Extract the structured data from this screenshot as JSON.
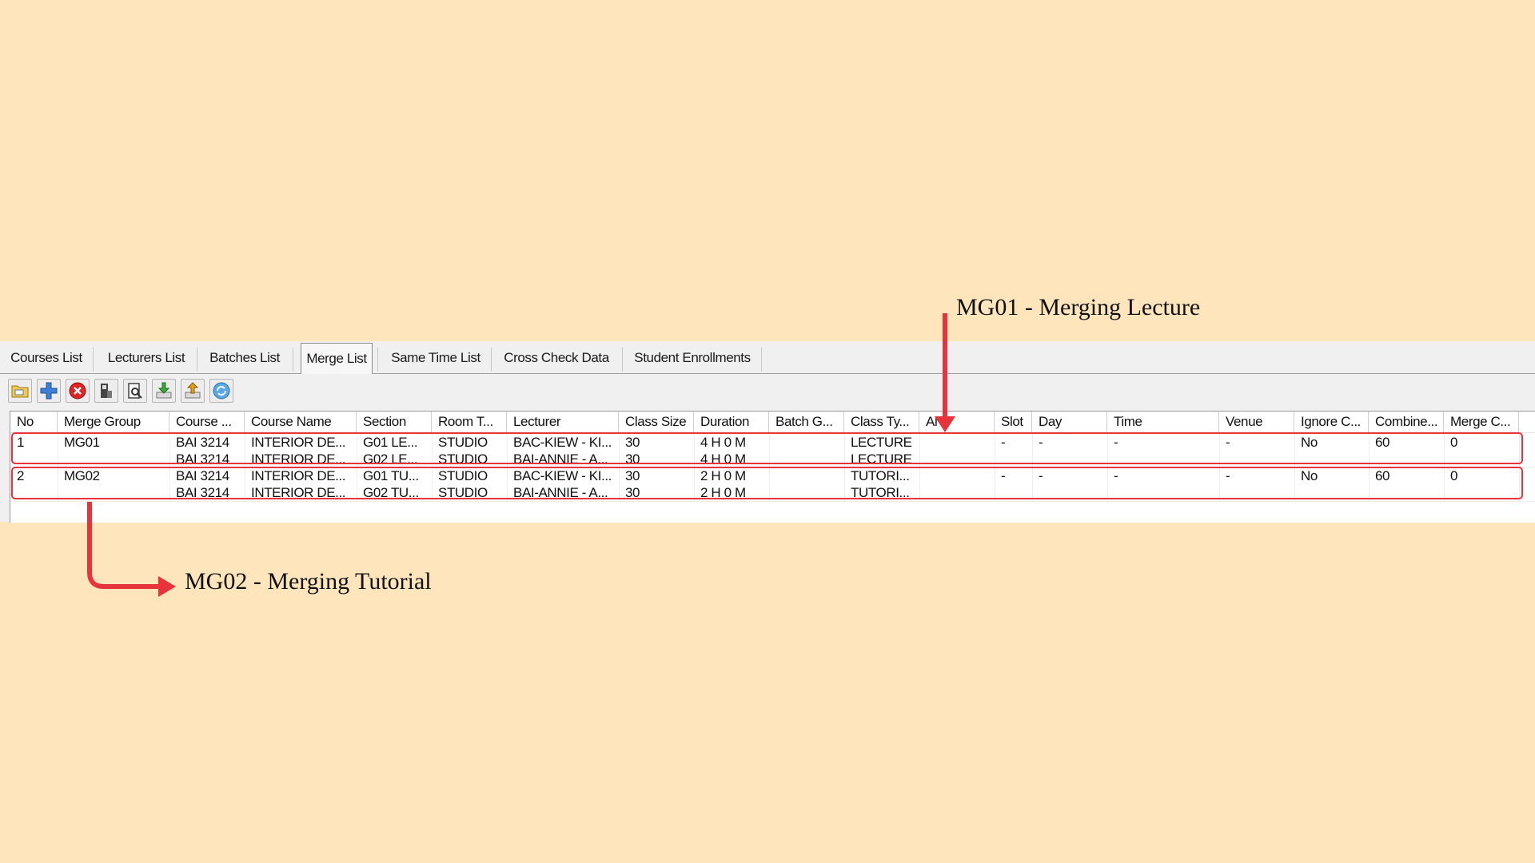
{
  "tabs": [
    {
      "label": "Courses List"
    },
    {
      "label": "Lecturers List"
    },
    {
      "label": "Batches List"
    },
    {
      "label": "Merge List",
      "active": true
    },
    {
      "label": "Same Time List"
    },
    {
      "label": "Cross Check Data"
    },
    {
      "label": "Student Enrollments"
    }
  ],
  "toolbar": [
    {
      "icon": "open-folder-icon"
    },
    {
      "icon": "add-icon"
    },
    {
      "icon": "delete-icon"
    },
    {
      "icon": "filter-icon"
    },
    {
      "icon": "find-icon"
    },
    {
      "icon": "import-icon"
    },
    {
      "icon": "export-icon"
    },
    {
      "icon": "refresh-icon"
    }
  ],
  "columns": [
    "No",
    "Merge Group",
    "Course ...",
    "Course Name",
    "Section",
    "Room T...",
    "Lecturer",
    "Class Size",
    "Duration",
    "Batch G...",
    "Class Ty...",
    "Al",
    "Slot",
    "Day",
    "Time",
    "Venue",
    "Ignore C...",
    "Combine...",
    "Merge C..."
  ],
  "rows": [
    {
      "no": "1",
      "merge_group": "MG01",
      "course": [
        "BAI 3214",
        "BAI 3214"
      ],
      "course_name": [
        "INTERIOR DE...",
        "INTERIOR DE..."
      ],
      "section": [
        "G01 LE...",
        "G02 LE..."
      ],
      "room_type": [
        "STUDIO",
        "STUDIO"
      ],
      "lecturer": [
        "BAC-KIEW - KI...",
        "BAI-ANNIE - A..."
      ],
      "class_size": [
        "30",
        "30"
      ],
      "duration": [
        "4 H 0 M",
        "4 H 0 M"
      ],
      "batch_group": [
        "",
        ""
      ],
      "class_type": [
        "LECTURE",
        "LECTURE"
      ],
      "allocated": "",
      "slot": "-",
      "day": "-",
      "time": "-",
      "venue": "-",
      "ignore_clash": "No",
      "combined": "60",
      "merge_count": "0"
    },
    {
      "no": "2",
      "merge_group": "MG02",
      "course": [
        "BAI 3214",
        "BAI 3214"
      ],
      "course_name": [
        "INTERIOR DE...",
        "INTERIOR DE..."
      ],
      "section": [
        "G01 TU...",
        "G02 TU..."
      ],
      "room_type": [
        "STUDIO",
        "STUDIO"
      ],
      "lecturer": [
        "BAC-KIEW - KI...",
        "BAI-ANNIE - A..."
      ],
      "class_size": [
        "30",
        "30"
      ],
      "duration": [
        "2 H 0 M",
        "2 H 0 M"
      ],
      "batch_group": [
        "",
        ""
      ],
      "class_type": [
        "TUTORI...",
        "TUTORI..."
      ],
      "allocated": "",
      "slot": "-",
      "day": "-",
      "time": "-",
      "venue": "-",
      "ignore_clash": "No",
      "combined": "60",
      "merge_count": "0"
    }
  ],
  "annotations": {
    "mg01": "MG01 - Merging Lecture",
    "mg02": "MG02 - Merging Tutorial"
  },
  "colors": {
    "background": "#FFE5BB",
    "highlight": "#E8333A",
    "panel": "#F0F0F0"
  }
}
